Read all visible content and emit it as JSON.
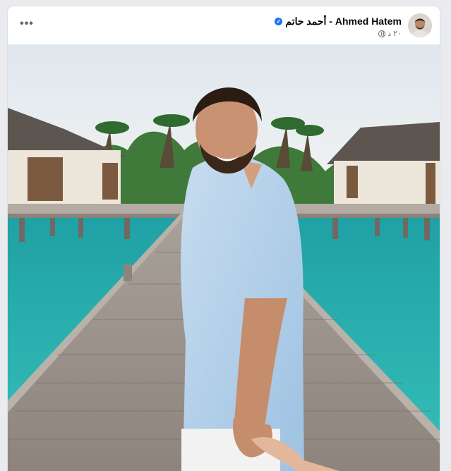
{
  "post": {
    "author_name": "أحمد حاتم - Ahmed Hatem",
    "timestamp": "٢٠ د",
    "more_options": "•••",
    "verified_mark": "✓",
    "verified_icon": "verified-badge-icon",
    "privacy_icon": "globe-icon",
    "accent_color": "#1877f2"
  },
  "photo": {
    "subject": "man in light blue shirt holding a hand on a wooden pier over turquoise water with overwater villas and palm trees"
  }
}
